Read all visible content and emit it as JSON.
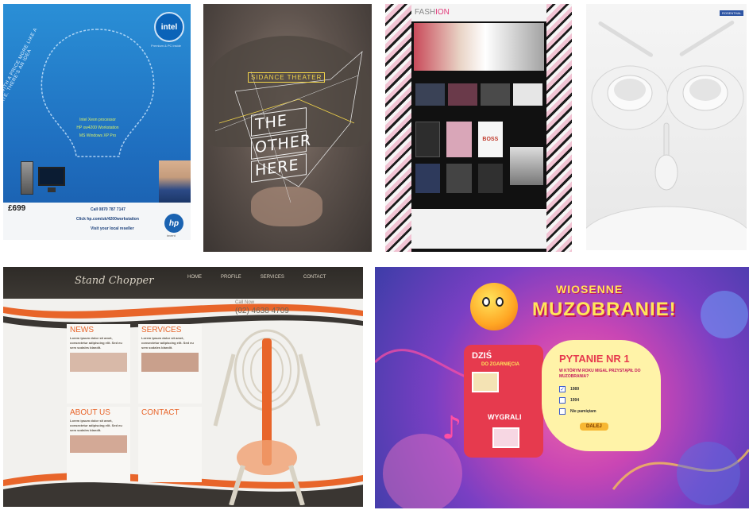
{
  "panels": {
    "intel_hp": {
      "intel_logo": "intel",
      "intel_tag": "Premium & PC inside",
      "slogan": "A POWERFUL WORKSTATION WITH A PRICE MORE LIKE A HEIGHTENED DEBATE. THERE'S AN IDEA",
      "price": "£699",
      "call_text": "Call 0870 787 7147",
      "click_text": "Click hp.com/uk/4200workstation",
      "reseller_text": "Visit your local reseller",
      "hp_logo": "hp",
      "hp_tag": "invent"
    },
    "poster": {
      "company": "SIDANCE THEATER",
      "title_lines": [
        "THE",
        "OTHER",
        "HERE"
      ]
    },
    "fashion": {
      "logo_a": "FASH",
      "logo_b": "ION",
      "boss_label": "BOSS"
    },
    "tableware": {
      "brand": "ROSENTHAL"
    },
    "stand_chopper": {
      "logo": "Stand Chopper",
      "nav": [
        "HOME",
        "PROFILE",
        "SERVICES",
        "CONTACT"
      ],
      "call_label": "Call Now",
      "phone": "(02) 4638 4709",
      "sections": [
        {
          "title": "NEWS",
          "lead": "Lorem ipsum dolor sit amet, consectetur adipiscing elit. Sed eu sem sodales blandit."
        },
        {
          "title": "SERVICES",
          "lead": "Lorem ipsum dolor sit amet, consectetur adipiscing elit. Sed eu sem sodales blandit."
        },
        {
          "title": "ABOUT US",
          "lead": "Lorem ipsum dolor sit amet, consectetur adipiscing elit. Sed eu sem sodales blandit."
        },
        {
          "title": "CONTACT",
          "lead": ""
        }
      ]
    },
    "muzobranie": {
      "title_top": "WIOSENNE",
      "title_main": "MUZOBRANIE!",
      "today_label": "DZIŚ",
      "today_sub": "DO ZGARNIĘCIA",
      "winners": "WYGRALI",
      "question_title": "PYTANIE NR 1",
      "question_text": "W KTÓRYM ROKU MIGAL PRZYSTĄPIŁ DO MUZOBRANIA?",
      "options": [
        "1989",
        "1994",
        "Nie pamiętam"
      ],
      "submit": "DALEJ"
    }
  }
}
